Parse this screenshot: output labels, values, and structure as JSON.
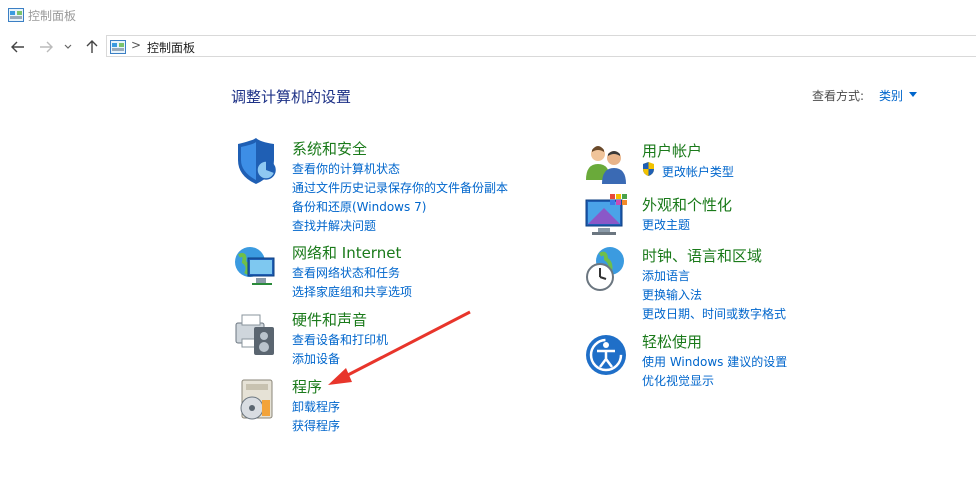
{
  "window": {
    "title": "控制面板"
  },
  "address": {
    "crumb": "控制面板",
    "separator": ">"
  },
  "header": {
    "heading": "调整计算机的设置",
    "view_by_label": "查看方式:",
    "view_by_value": "类别"
  },
  "categories": {
    "system": {
      "title": "系统和安全",
      "links": [
        "查看你的计算机状态",
        "通过文件历史记录保存你的文件备份副本",
        "备份和还原(Windows 7)",
        "查找并解决问题"
      ]
    },
    "network": {
      "title": "网络和 Internet",
      "links": [
        "查看网络状态和任务",
        "选择家庭组和共享选项"
      ]
    },
    "hardware": {
      "title": "硬件和声音",
      "links": [
        "查看设备和打印机",
        "添加设备"
      ]
    },
    "programs": {
      "title": "程序",
      "links": [
        "卸载程序",
        "获得程序"
      ]
    },
    "users": {
      "title": "用户帐户",
      "links": [
        "更改帐户类型"
      ]
    },
    "appearance": {
      "title": "外观和个性化",
      "links": [
        "更改主题"
      ]
    },
    "clock": {
      "title": "时钟、语言和区域",
      "links": [
        "添加语言",
        "更换输入法",
        "更改日期、时间或数字格式"
      ]
    },
    "ease": {
      "title": "轻松使用",
      "links": [
        "使用 Windows 建议的设置",
        "优化视觉显示"
      ]
    }
  },
  "colors": {
    "link": "#0066cc",
    "category_title": "#1a7a1a",
    "heading": "#1e3287",
    "annotation_arrow": "#e8352b"
  }
}
